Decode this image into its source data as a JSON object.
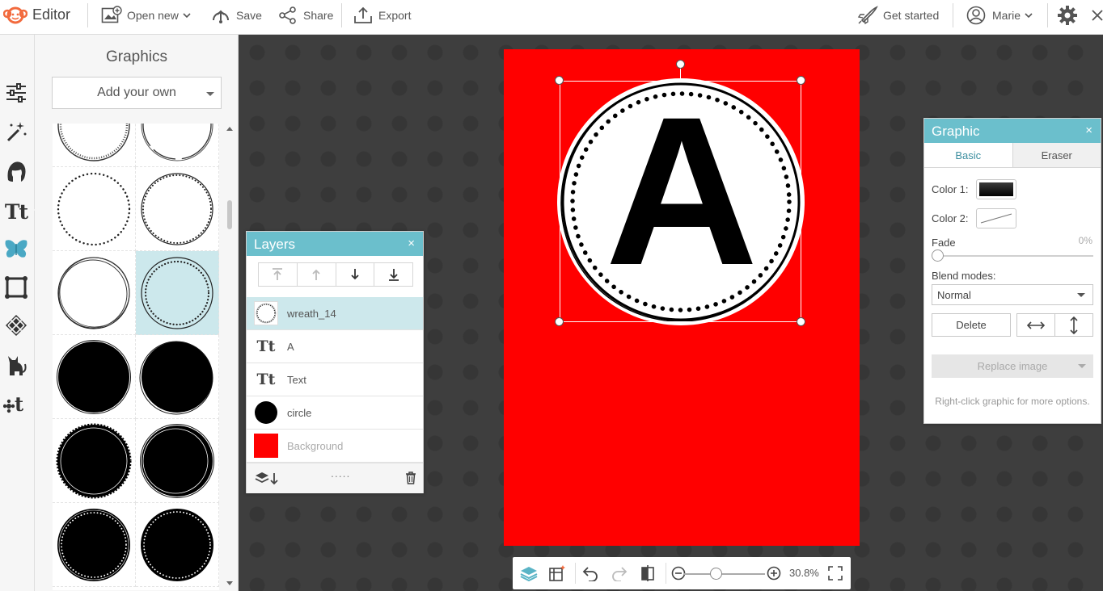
{
  "header": {
    "app_title": "Editor",
    "open_new": "Open new",
    "save": "Save",
    "share": "Share",
    "export": "Export",
    "get_started": "Get started",
    "user": "Marie"
  },
  "rail": {
    "icons": [
      "adjustments-icon",
      "magic-wand-icon",
      "face-icon",
      "text-icon",
      "butterfly-icon",
      "frame-icon",
      "texture-icon",
      "cat-icon",
      "my-stuff-icon"
    ],
    "active": "butterfly-icon"
  },
  "graphics_panel": {
    "title": "Graphics",
    "dropdown_value": "Add your own"
  },
  "canvas": {
    "artboard_color": "#ff0000",
    "letter": "A"
  },
  "layers_panel": {
    "title": "Layers",
    "close": "×",
    "items": [
      {
        "name": "wreath_14",
        "icon": "wreath-thumb",
        "active": true
      },
      {
        "name": "A",
        "icon": "text-icon"
      },
      {
        "name": "Text",
        "icon": "text-icon"
      },
      {
        "name": "circle",
        "icon": "circle-thumb"
      },
      {
        "name": "Background",
        "icon": "background-thumb"
      }
    ],
    "footer_dots": "....."
  },
  "graphic_panel": {
    "title": "Graphic",
    "close": "×",
    "tabs": {
      "basic": "Basic",
      "eraser": "Eraser"
    },
    "color1_label": "Color 1:",
    "color2_label": "Color 2:",
    "fade_label": "Fade",
    "fade_value": "0%",
    "blend_label": "Blend modes:",
    "blend_value": "Normal",
    "delete_label": "Delete",
    "replace_label": "Replace image",
    "hint": "Right-click graphic for more options.",
    "color1": "#1a1a1a"
  },
  "zoom": {
    "value": "30.8%",
    "fraction": 0.3
  },
  "colors": {
    "accent": "#6bbfcc",
    "brand": "#f26a3d",
    "selection": "#cde8ec"
  }
}
